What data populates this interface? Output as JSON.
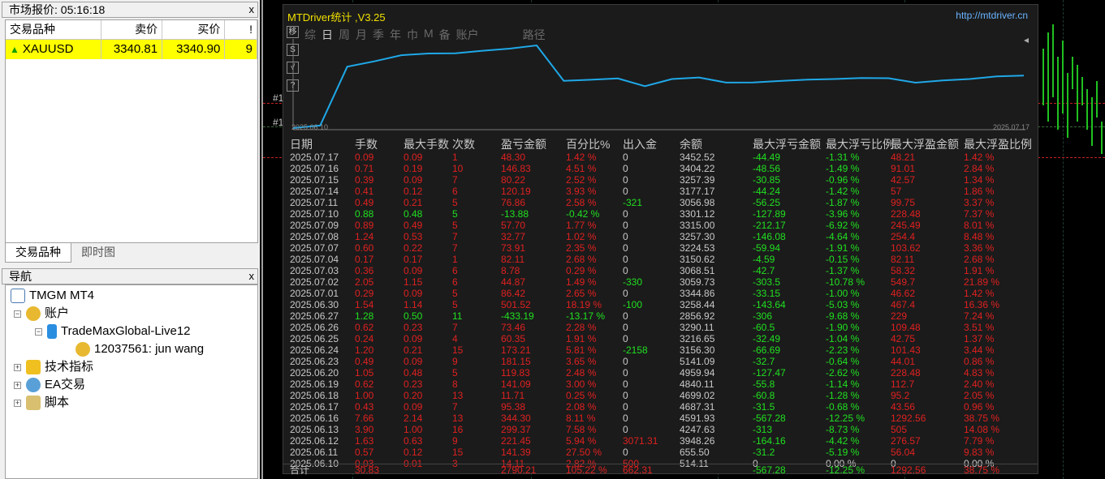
{
  "market_watch": {
    "title": "市场报价: 05:16:18",
    "close": "x",
    "headers": [
      "交易品种",
      "卖价",
      "买价",
      "!"
    ],
    "row": {
      "symbol": "XAUUSD",
      "bid": "3340.81",
      "ask": "3340.90",
      "spread": "9"
    },
    "tabs": [
      "交易品种",
      "即时图"
    ]
  },
  "navigator": {
    "title": "导航",
    "close": "x",
    "items": [
      "TMGM MT4",
      "账户",
      "TradeMaxGlobal-Live12",
      "12037561: jun wang",
      "技术指标",
      "EA交易",
      "脚本"
    ]
  },
  "chart": {
    "left_labels": [
      "#1",
      "#1"
    ]
  },
  "panel": {
    "title": "MTDriver统计 ,V3.25",
    "url": "http://mtdriver.cn",
    "tabs": [
      "综",
      "日",
      "周",
      "月",
      "季",
      "年",
      "巾",
      "M",
      "备",
      "账户",
      "",
      "路径"
    ],
    "active_tab": 1,
    "side_buttons": [
      "移",
      "S",
      "√",
      "?"
    ],
    "chart_start": "2025.06.10",
    "chart_end": "2025.07.17",
    "balance_curve": [
      514.11,
      655.5,
      3948.26,
      4247.63,
      4591.93,
      4687.31,
      4699.02,
      4840.11,
      4959.94,
      5141.09,
      3156.3,
      3216.65,
      3290.11,
      2856.92,
      3258.44,
      3344.86,
      3059.73,
      3068.51,
      3150.62,
      3224.53,
      3257.3,
      3315.0,
      3301.12,
      3056.98,
      3177.17,
      3257.39,
      3404.22,
      3452.52
    ],
    "headers": [
      "日期",
      "手数",
      "最大手数",
      "次数",
      "盈亏金额",
      "百分比%",
      "出入金",
      "余额",
      "最大浮亏金额",
      "最大浮亏比例",
      "最大浮盈金额",
      "最大浮盈比例"
    ],
    "rows": [
      [
        "2025.07.17",
        "0.09",
        "0.09",
        "1",
        "48.30",
        "1.42 %",
        "0",
        "3452.52",
        "-44.49",
        "-1.31 %",
        "48.21",
        "1.42 %",
        "r"
      ],
      [
        "2025.07.16",
        "0.71",
        "0.19",
        "10",
        "146.83",
        "4.51 %",
        "0",
        "3404.22",
        "-48.56",
        "-1.49 %",
        "91.01",
        "2.84 %",
        "r"
      ],
      [
        "2025.07.15",
        "0.39",
        "0.09",
        "7",
        "80.22",
        "2.52 %",
        "0",
        "3257.39",
        "-30.85",
        "-0.96 %",
        "42.57",
        "1.34 %",
        "r"
      ],
      [
        "2025.07.14",
        "0.41",
        "0.12",
        "6",
        "120.19",
        "3.93 %",
        "0",
        "3177.17",
        "-44.24",
        "-1.42 %",
        "57",
        "1.86 %",
        "r"
      ],
      [
        "2025.07.11",
        "0.49",
        "0.21",
        "5",
        "76.86",
        "2.58 %",
        "-321",
        "3056.98",
        "-56.25",
        "-1.87 %",
        "99.75",
        "3.37 %",
        "r"
      ],
      [
        "2025.07.10",
        "0.88",
        "0.48",
        "5",
        "-13.88",
        "-0.42 %",
        "0",
        "3301.12",
        "-127.89",
        "-3.96 %",
        "228.48",
        "7.37 %",
        "g"
      ],
      [
        "2025.07.09",
        "0.89",
        "0.49",
        "5",
        "57.70",
        "1.77 %",
        "0",
        "3315.00",
        "-212.17",
        "-6.92 %",
        "245.49",
        "8.01 %",
        "r"
      ],
      [
        "2025.07.08",
        "1.24",
        "0.53",
        "7",
        "32.77",
        "1.02 %",
        "0",
        "3257.30",
        "-146.08",
        "-4.64 %",
        "254.4",
        "8.48 %",
        "r"
      ],
      [
        "2025.07.07",
        "0.60",
        "0.22",
        "7",
        "73.91",
        "2.35 %",
        "0",
        "3224.53",
        "-59.94",
        "-1.91 %",
        "103.62",
        "3.36 %",
        "r"
      ],
      [
        "2025.07.04",
        "0.17",
        "0.17",
        "1",
        "82.11",
        "2.68 %",
        "0",
        "3150.62",
        "-4.59",
        "-0.15 %",
        "82.11",
        "2.68 %",
        "r"
      ],
      [
        "2025.07.03",
        "0.36",
        "0.09",
        "6",
        "8.78",
        "0.29 %",
        "0",
        "3068.51",
        "-42.7",
        "-1.37 %",
        "58.32",
        "1.91 %",
        "r"
      ],
      [
        "2025.07.02",
        "2.05",
        "1.15",
        "6",
        "44.87",
        "1.49 %",
        "-330",
        "3059.73",
        "-303.5",
        "-10.78 %",
        "549.7",
        "21.89 %",
        "r"
      ],
      [
        "2025.07.01",
        "0.29",
        "0.09",
        "5",
        "86.42",
        "2.65 %",
        "0",
        "3344.86",
        "-33.15",
        "-1.00 %",
        "46.62",
        "1.42 %",
        "r"
      ],
      [
        "2025.06.30",
        "1.54",
        "1.14",
        "5",
        "501.52",
        "18.19 %",
        "-100",
        "3258.44",
        "-143.64",
        "-5.03 %",
        "467.4",
        "16.36 %",
        "r"
      ],
      [
        "2025.06.27",
        "1.28",
        "0.50",
        "11",
        "-433.19",
        "-13.17 %",
        "0",
        "2856.92",
        "-306",
        "-9.68 %",
        "229",
        "7.24 %",
        "g"
      ],
      [
        "2025.06.26",
        "0.62",
        "0.23",
        "7",
        "73.46",
        "2.28 %",
        "0",
        "3290.11",
        "-60.5",
        "-1.90 %",
        "109.48",
        "3.51 %",
        "r"
      ],
      [
        "2025.06.25",
        "0.24",
        "0.09",
        "4",
        "60.35",
        "1.91 %",
        "0",
        "3216.65",
        "-32.49",
        "-1.04 %",
        "42.75",
        "1.37 %",
        "r"
      ],
      [
        "2025.06.24",
        "1.20",
        "0.21",
        "15",
        "173.21",
        "5.81 %",
        "-2158",
        "3156.30",
        "-66.69",
        "-2.23 %",
        "101.43",
        "3.44 %",
        "r"
      ],
      [
        "2025.06.23",
        "0.49",
        "0.09",
        "9",
        "181.15",
        "3.65 %",
        "0",
        "5141.09",
        "-32.7",
        "-0.64 %",
        "44.01",
        "0.86 %",
        "r"
      ],
      [
        "2025.06.20",
        "1.05",
        "0.48",
        "5",
        "119.83",
        "2.48 %",
        "0",
        "4959.94",
        "-127.47",
        "-2.62 %",
        "228.48",
        "4.83 %",
        "r"
      ],
      [
        "2025.06.19",
        "0.62",
        "0.23",
        "8",
        "141.09",
        "3.00 %",
        "0",
        "4840.11",
        "-55.8",
        "-1.14 %",
        "112.7",
        "2.40 %",
        "r"
      ],
      [
        "2025.06.18",
        "1.00",
        "0.20",
        "13",
        "11.71",
        "0.25 %",
        "0",
        "4699.02",
        "-60.8",
        "-1.28 %",
        "95.2",
        "2.05 %",
        "r"
      ],
      [
        "2025.06.17",
        "0.43",
        "0.09",
        "7",
        "95.38",
        "2.08 %",
        "0",
        "4687.31",
        "-31.5",
        "-0.68 %",
        "43.56",
        "0.96 %",
        "r"
      ],
      [
        "2025.06.16",
        "7.66",
        "2.14",
        "13",
        "344.30",
        "8.11 %",
        "0",
        "4591.93",
        "-567.28",
        "-12.25 %",
        "1292.56",
        "38.75 %",
        "r"
      ],
      [
        "2025.06.13",
        "3.90",
        "1.00",
        "16",
        "299.37",
        "7.58 %",
        "0",
        "4247.63",
        "-313",
        "-8.73 %",
        "505",
        "14.08 %",
        "r"
      ],
      [
        "2025.06.12",
        "1.63",
        "0.63",
        "9",
        "221.45",
        "5.94 %",
        "3071.31",
        "3948.26",
        "-164.16",
        "-4.42 %",
        "276.57",
        "7.79 %",
        "r"
      ],
      [
        "2025.06.11",
        "0.57",
        "0.12",
        "15",
        "141.39",
        "27.50 %",
        "0",
        "655.50",
        "-31.2",
        "-5.19 %",
        "56.04",
        "9.83 %",
        "r"
      ],
      [
        "2025.06.10",
        "0.03",
        "0.01",
        "3",
        "14.11",
        "2.82 %",
        "500",
        "514.11",
        "0",
        "0.00 %",
        "0",
        "0.00 %",
        "r"
      ]
    ],
    "total": {
      "label": "合计",
      "lots": "30.83",
      "pnl": "2790.21",
      "pct": "105.22 %",
      "dep": "662.31",
      "maxloss": "-567.28",
      "maxlosspct": "-12.25 %",
      "maxprofit": "1292.56",
      "maxprofitpct": "38.75 %"
    }
  },
  "colors": {
    "profit": "#e02020",
    "loss": "#20e020",
    "curve": "#1fa8e8",
    "title": "#f0e000"
  }
}
